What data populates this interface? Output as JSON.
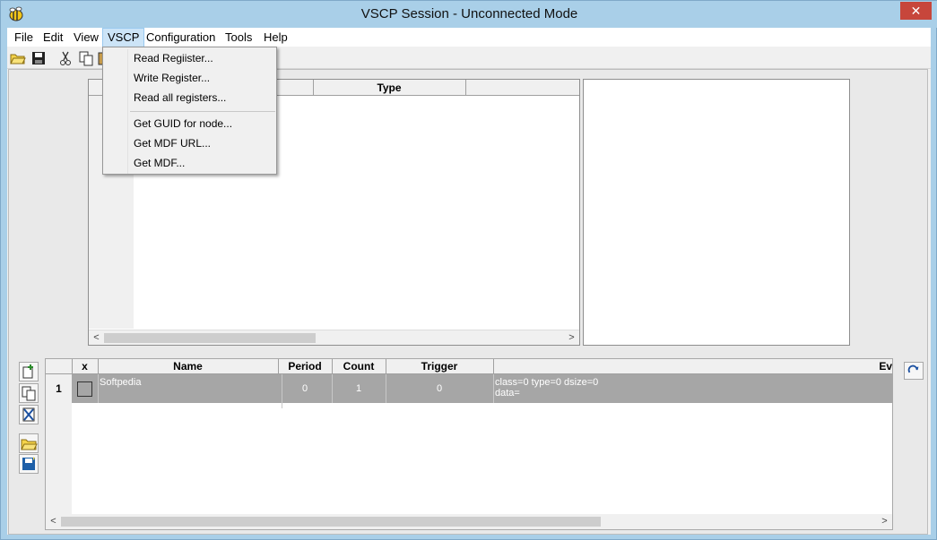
{
  "window": {
    "title": "VSCP Session - Unconnected Mode",
    "close_glyph": "✕"
  },
  "menubar": {
    "items": [
      {
        "label": "File"
      },
      {
        "label": "Edit"
      },
      {
        "label": "View"
      },
      {
        "label": "VSCP",
        "active": true
      },
      {
        "label": "Configuration"
      },
      {
        "label": "Tools"
      },
      {
        "label": "Help"
      }
    ]
  },
  "toolbar": {
    "icons": [
      "open-folder-icon",
      "save-icon",
      "cut-icon",
      "copy-icon",
      "paste-icon"
    ]
  },
  "vscp_menu": {
    "items": [
      {
        "label": "Read Regiister..."
      },
      {
        "label": "Write Register..."
      },
      {
        "label": "Read all registers..."
      },
      {
        "label": "Get GUID for node..."
      },
      {
        "label": "Get MDF URL..."
      },
      {
        "label": "Get MDF..."
      }
    ]
  },
  "register_grid": {
    "columns": [
      "",
      "Type",
      ""
    ],
    "scroll_left": "<",
    "scroll_right": ">"
  },
  "event_grid": {
    "columns": {
      "x": "x",
      "name": "Name",
      "period": "Period",
      "count": "Count",
      "trigger": "Trigger",
      "event": "Ev"
    },
    "rows": [
      {
        "row_header": "1",
        "name": "Softpedia",
        "period": "0",
        "count": "1",
        "trigger": "0",
        "event_line1": "class=0 type=0 dsize=0",
        "event_line2": "data="
      }
    ],
    "scroll_left": "<",
    "scroll_right": ">"
  },
  "colors": {
    "titlebar": "#a9cfe8",
    "close": "#c7463b",
    "row_selected": "#a6a6a6",
    "menu_active": "#cce4f7"
  }
}
